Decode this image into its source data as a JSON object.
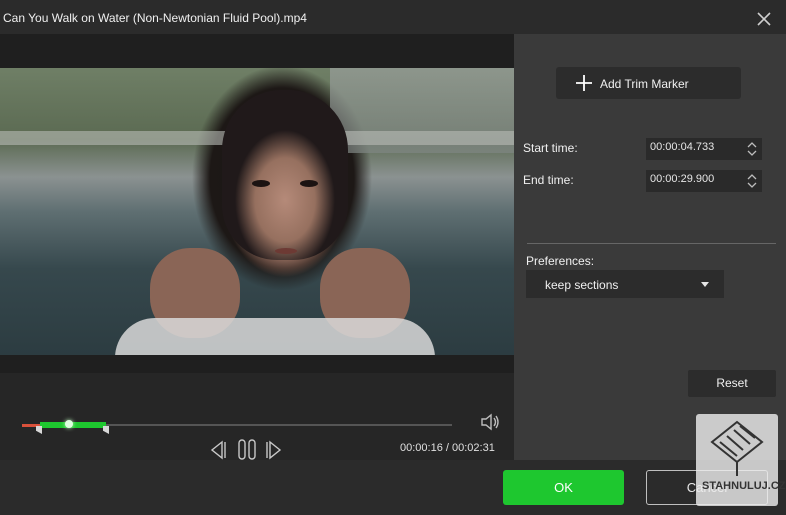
{
  "window": {
    "title": "Can You Walk on Water (Non-Newtonian Fluid Pool).mp4",
    "close_icon": "close-icon"
  },
  "player": {
    "time_display": "00:00:16 / 00:02:31",
    "icons": [
      "volume-icon",
      "previous-frame-icon",
      "pause-icon",
      "next-frame-icon"
    ]
  },
  "panel": {
    "add_marker_label": "Add Trim Marker",
    "start_label": "Start time:",
    "start_value": "00:00:04.733",
    "end_label": "End time:",
    "end_value": "00:00:29.900",
    "preferences_label": "Preferences:",
    "preferences_value": "keep sections",
    "reset_label": "Reset"
  },
  "footer": {
    "ok_label": "OK",
    "cancel_label": "Cancel"
  },
  "watermark": {
    "text": "STAHNULUJ.CZ"
  },
  "colors": {
    "accent_green": "#1ec72f",
    "marker_red": "#d9513b",
    "panel_bg": "#3a3a3a"
  }
}
